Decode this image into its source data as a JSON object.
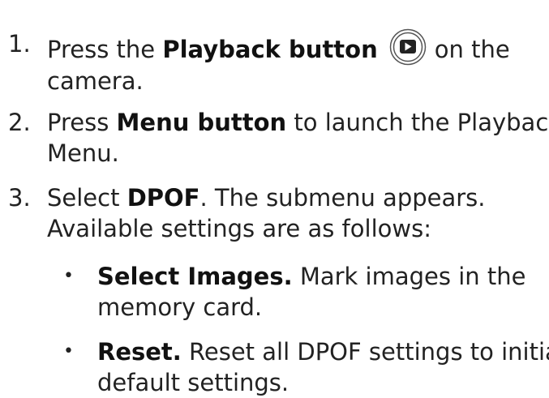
{
  "steps": [
    {
      "num": "1.",
      "pre": "Press the ",
      "bold": "Playback button",
      "post": "on the",
      "line2": "camera.",
      "icon": "playback-button-icon"
    },
    {
      "num": "2.",
      "pre": "Press ",
      "bold": "Menu button",
      "post": " to launch the Playback",
      "line2": "Menu."
    },
    {
      "num": "3.",
      "pre": "Select ",
      "bold": "DPOF",
      "post": ". The submenu appears.",
      "line2": "Available settings are as follows:"
    }
  ],
  "bullets": [
    {
      "dot": "•",
      "bold": "Select Images.",
      "post": " Mark images in the",
      "line2": "memory card."
    },
    {
      "dot": "•",
      "bold": "Reset.",
      "post": " Reset all DPOF settings to initial",
      "line2": "default settings."
    }
  ]
}
